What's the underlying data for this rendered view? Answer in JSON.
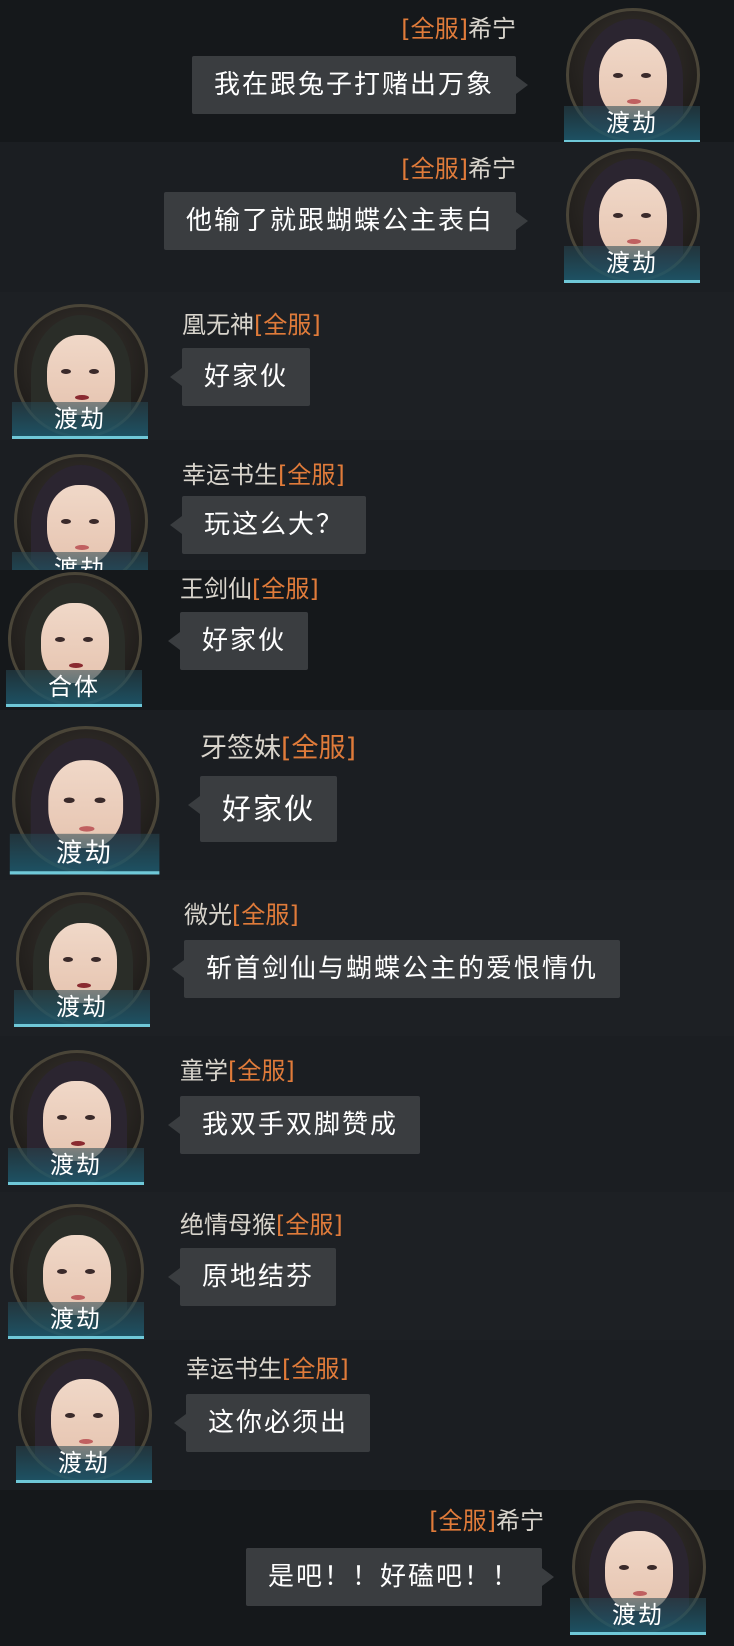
{
  "messages": [
    {
      "sender": "希宁",
      "tag": "[全服]",
      "text": "我在跟兔子打赌出万象",
      "rank": "渡劫",
      "side": "right"
    },
    {
      "sender": "希宁",
      "tag": "[全服]",
      "text": "他输了就跟蝴蝶公主表白",
      "rank": "渡劫",
      "side": "right"
    },
    {
      "sender": "凰无神",
      "tag": "[全服]",
      "text": "好家伙",
      "rank": "渡劫",
      "side": "left"
    },
    {
      "sender": "幸运书生",
      "tag": "[全服]",
      "text": "玩这么大？",
      "rank": "渡劫",
      "side": "left"
    },
    {
      "sender": "王剑仙",
      "tag": "[全服]",
      "text": "好家伙",
      "rank": "合体",
      "side": "left"
    },
    {
      "sender": "牙签妹",
      "tag": "[全服]",
      "text": "好家伙",
      "rank": "渡劫",
      "side": "left"
    },
    {
      "sender": "微光",
      "tag": "[全服]",
      "text": "斩首剑仙与蝴蝶公主的爱恨情仇",
      "rank": "渡劫",
      "side": "left"
    },
    {
      "sender": "童学",
      "tag": "[全服]",
      "text": "我双手双脚赞成",
      "rank": "渡劫",
      "side": "left"
    },
    {
      "sender": "绝情母猴",
      "tag": "[全服]",
      "text": "原地结芬",
      "rank": "渡劫",
      "side": "left"
    },
    {
      "sender": "幸运书生",
      "tag": "[全服]",
      "text": "这你必须出",
      "rank": "渡劫",
      "side": "left"
    },
    {
      "sender": "希宁",
      "tag": "[全服]",
      "text": "是吧！！好磕吧！！",
      "rank": "渡劫",
      "side": "right"
    }
  ],
  "icons": {
    "avatar": "character-portrait-icon"
  },
  "colors": {
    "tag": "#e07b3a",
    "name": "#d8d4cc",
    "bubble": "#3a3d40",
    "rank_bar": "#1e5a6e"
  }
}
